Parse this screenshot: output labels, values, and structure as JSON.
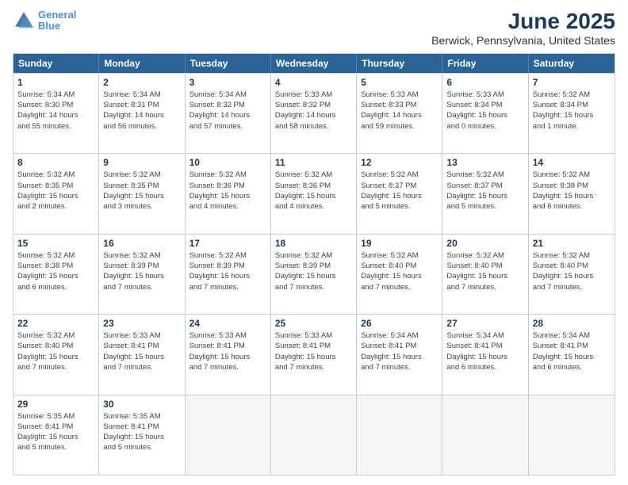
{
  "logo": {
    "line1": "General",
    "line2": "Blue"
  },
  "title": "June 2025",
  "subtitle": "Berwick, Pennsylvania, United States",
  "days_of_week": [
    "Sunday",
    "Monday",
    "Tuesday",
    "Wednesday",
    "Thursday",
    "Friday",
    "Saturday"
  ],
  "weeks": [
    [
      {
        "day": 1,
        "info": "Sunrise: 5:34 AM\nSunset: 8:30 PM\nDaylight: 14 hours\nand 55 minutes."
      },
      {
        "day": 2,
        "info": "Sunrise: 5:34 AM\nSunset: 8:31 PM\nDaylight: 14 hours\nand 56 minutes."
      },
      {
        "day": 3,
        "info": "Sunrise: 5:34 AM\nSunset: 8:32 PM\nDaylight: 14 hours\nand 57 minutes."
      },
      {
        "day": 4,
        "info": "Sunrise: 5:33 AM\nSunset: 8:32 PM\nDaylight: 14 hours\nand 58 minutes."
      },
      {
        "day": 5,
        "info": "Sunrise: 5:33 AM\nSunset: 8:33 PM\nDaylight: 14 hours\nand 59 minutes."
      },
      {
        "day": 6,
        "info": "Sunrise: 5:33 AM\nSunset: 8:34 PM\nDaylight: 15 hours\nand 0 minutes."
      },
      {
        "day": 7,
        "info": "Sunrise: 5:32 AM\nSunset: 8:34 PM\nDaylight: 15 hours\nand 1 minute."
      }
    ],
    [
      {
        "day": 8,
        "info": "Sunrise: 5:32 AM\nSunset: 8:35 PM\nDaylight: 15 hours\nand 2 minutes."
      },
      {
        "day": 9,
        "info": "Sunrise: 5:32 AM\nSunset: 8:35 PM\nDaylight: 15 hours\nand 3 minutes."
      },
      {
        "day": 10,
        "info": "Sunrise: 5:32 AM\nSunset: 8:36 PM\nDaylight: 15 hours\nand 4 minutes."
      },
      {
        "day": 11,
        "info": "Sunrise: 5:32 AM\nSunset: 8:36 PM\nDaylight: 15 hours\nand 4 minutes."
      },
      {
        "day": 12,
        "info": "Sunrise: 5:32 AM\nSunset: 8:37 PM\nDaylight: 15 hours\nand 5 minutes."
      },
      {
        "day": 13,
        "info": "Sunrise: 5:32 AM\nSunset: 8:37 PM\nDaylight: 15 hours\nand 5 minutes."
      },
      {
        "day": 14,
        "info": "Sunrise: 5:32 AM\nSunset: 8:38 PM\nDaylight: 15 hours\nand 6 minutes."
      }
    ],
    [
      {
        "day": 15,
        "info": "Sunrise: 5:32 AM\nSunset: 8:38 PM\nDaylight: 15 hours\nand 6 minutes."
      },
      {
        "day": 16,
        "info": "Sunrise: 5:32 AM\nSunset: 8:39 PM\nDaylight: 15 hours\nand 7 minutes."
      },
      {
        "day": 17,
        "info": "Sunrise: 5:32 AM\nSunset: 8:39 PM\nDaylight: 15 hours\nand 7 minutes."
      },
      {
        "day": 18,
        "info": "Sunrise: 5:32 AM\nSunset: 8:39 PM\nDaylight: 15 hours\nand 7 minutes."
      },
      {
        "day": 19,
        "info": "Sunrise: 5:32 AM\nSunset: 8:40 PM\nDaylight: 15 hours\nand 7 minutes."
      },
      {
        "day": 20,
        "info": "Sunrise: 5:32 AM\nSunset: 8:40 PM\nDaylight: 15 hours\nand 7 minutes."
      },
      {
        "day": 21,
        "info": "Sunrise: 5:32 AM\nSunset: 8:40 PM\nDaylight: 15 hours\nand 7 minutes."
      }
    ],
    [
      {
        "day": 22,
        "info": "Sunrise: 5:32 AM\nSunset: 8:40 PM\nDaylight: 15 hours\nand 7 minutes."
      },
      {
        "day": 23,
        "info": "Sunrise: 5:33 AM\nSunset: 8:41 PM\nDaylight: 15 hours\nand 7 minutes."
      },
      {
        "day": 24,
        "info": "Sunrise: 5:33 AM\nSunset: 8:41 PM\nDaylight: 15 hours\nand 7 minutes."
      },
      {
        "day": 25,
        "info": "Sunrise: 5:33 AM\nSunset: 8:41 PM\nDaylight: 15 hours\nand 7 minutes."
      },
      {
        "day": 26,
        "info": "Sunrise: 5:34 AM\nSunset: 8:41 PM\nDaylight: 15 hours\nand 7 minutes."
      },
      {
        "day": 27,
        "info": "Sunrise: 5:34 AM\nSunset: 8:41 PM\nDaylight: 15 hours\nand 6 minutes."
      },
      {
        "day": 28,
        "info": "Sunrise: 5:34 AM\nSunset: 8:41 PM\nDaylight: 15 hours\nand 6 minutes."
      }
    ],
    [
      {
        "day": 29,
        "info": "Sunrise: 5:35 AM\nSunset: 8:41 PM\nDaylight: 15 hours\nand 5 minutes."
      },
      {
        "day": 30,
        "info": "Sunrise: 5:35 AM\nSunset: 8:41 PM\nDaylight: 15 hours\nand 5 minutes."
      },
      null,
      null,
      null,
      null,
      null
    ]
  ]
}
